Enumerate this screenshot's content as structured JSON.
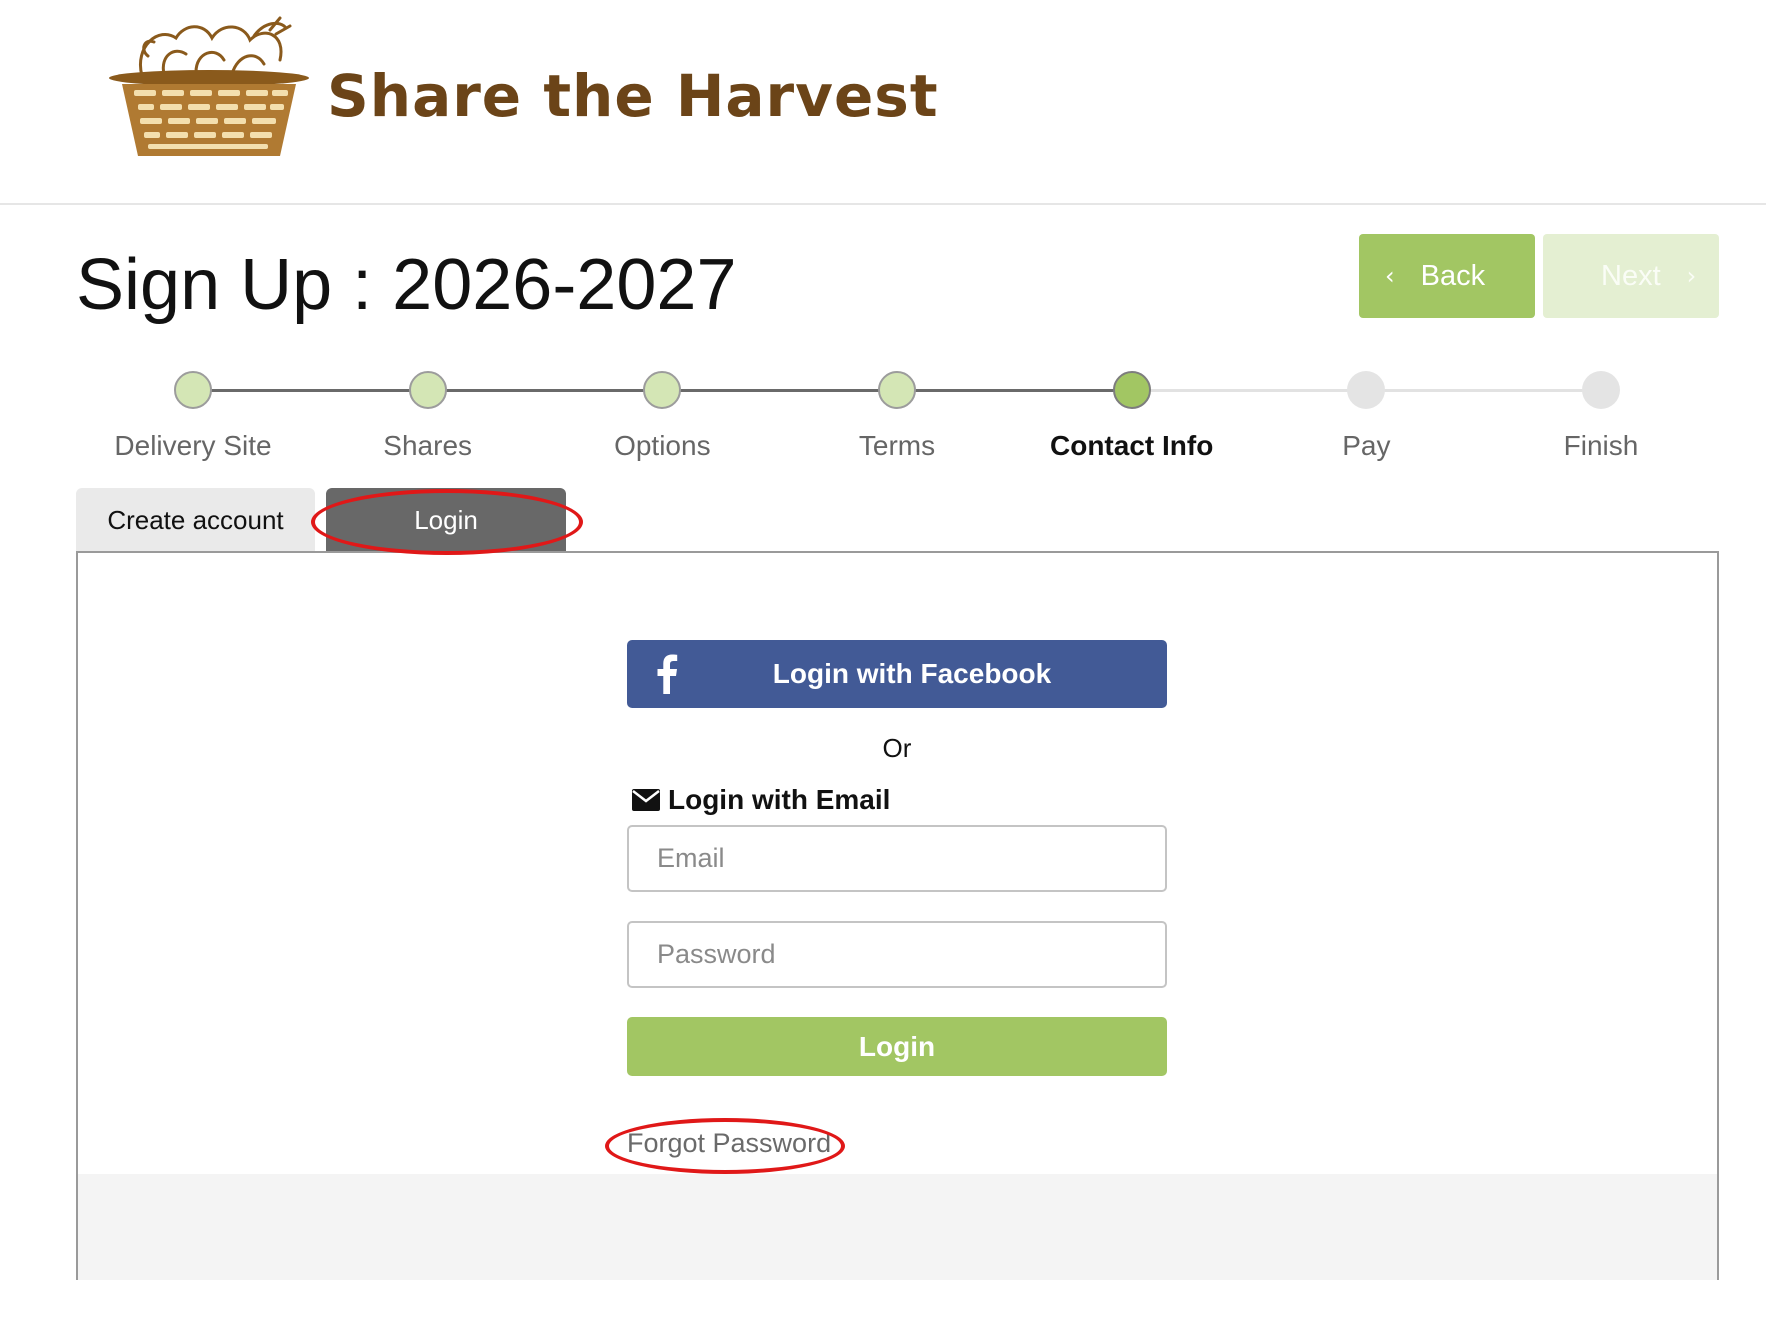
{
  "brand": {
    "name": "Share the Harvest"
  },
  "page": {
    "title": "Sign Up : 2026-2027"
  },
  "nav": {
    "back_label": "Back",
    "next_label": "Next"
  },
  "steps": [
    {
      "label": "Delivery Site",
      "state": "done"
    },
    {
      "label": "Shares",
      "state": "done"
    },
    {
      "label": "Options",
      "state": "done"
    },
    {
      "label": "Terms",
      "state": "done"
    },
    {
      "label": "Contact Info",
      "state": "current"
    },
    {
      "label": "Pay",
      "state": "todo"
    },
    {
      "label": "Finish",
      "state": "todo"
    }
  ],
  "tabs": {
    "create_account": "Create account",
    "login": "Login",
    "active": "login"
  },
  "login": {
    "facebook_label": "Login with Facebook",
    "or_text": "Or",
    "email_heading": "Login with Email",
    "email_placeholder": "Email",
    "password_placeholder": "Password",
    "submit_label": "Login",
    "forgot_label": "Forgot Password"
  },
  "icons": {
    "logo": "harvest-basket-icon",
    "back": "chevron-left-icon",
    "next": "chevron-right-icon",
    "facebook": "facebook-icon",
    "mail": "mail-icon"
  },
  "colors": {
    "brand_brown": "#6b4418",
    "accent_green": "#a2c663",
    "accent_green_disabled": "#e4efd2",
    "step_done": "#d4e6b5",
    "step_current": "#a2c663",
    "step_todo": "#e4e4e4",
    "facebook_blue": "#425a96",
    "tab_active": "#686868",
    "annotation_red": "#e01818"
  }
}
